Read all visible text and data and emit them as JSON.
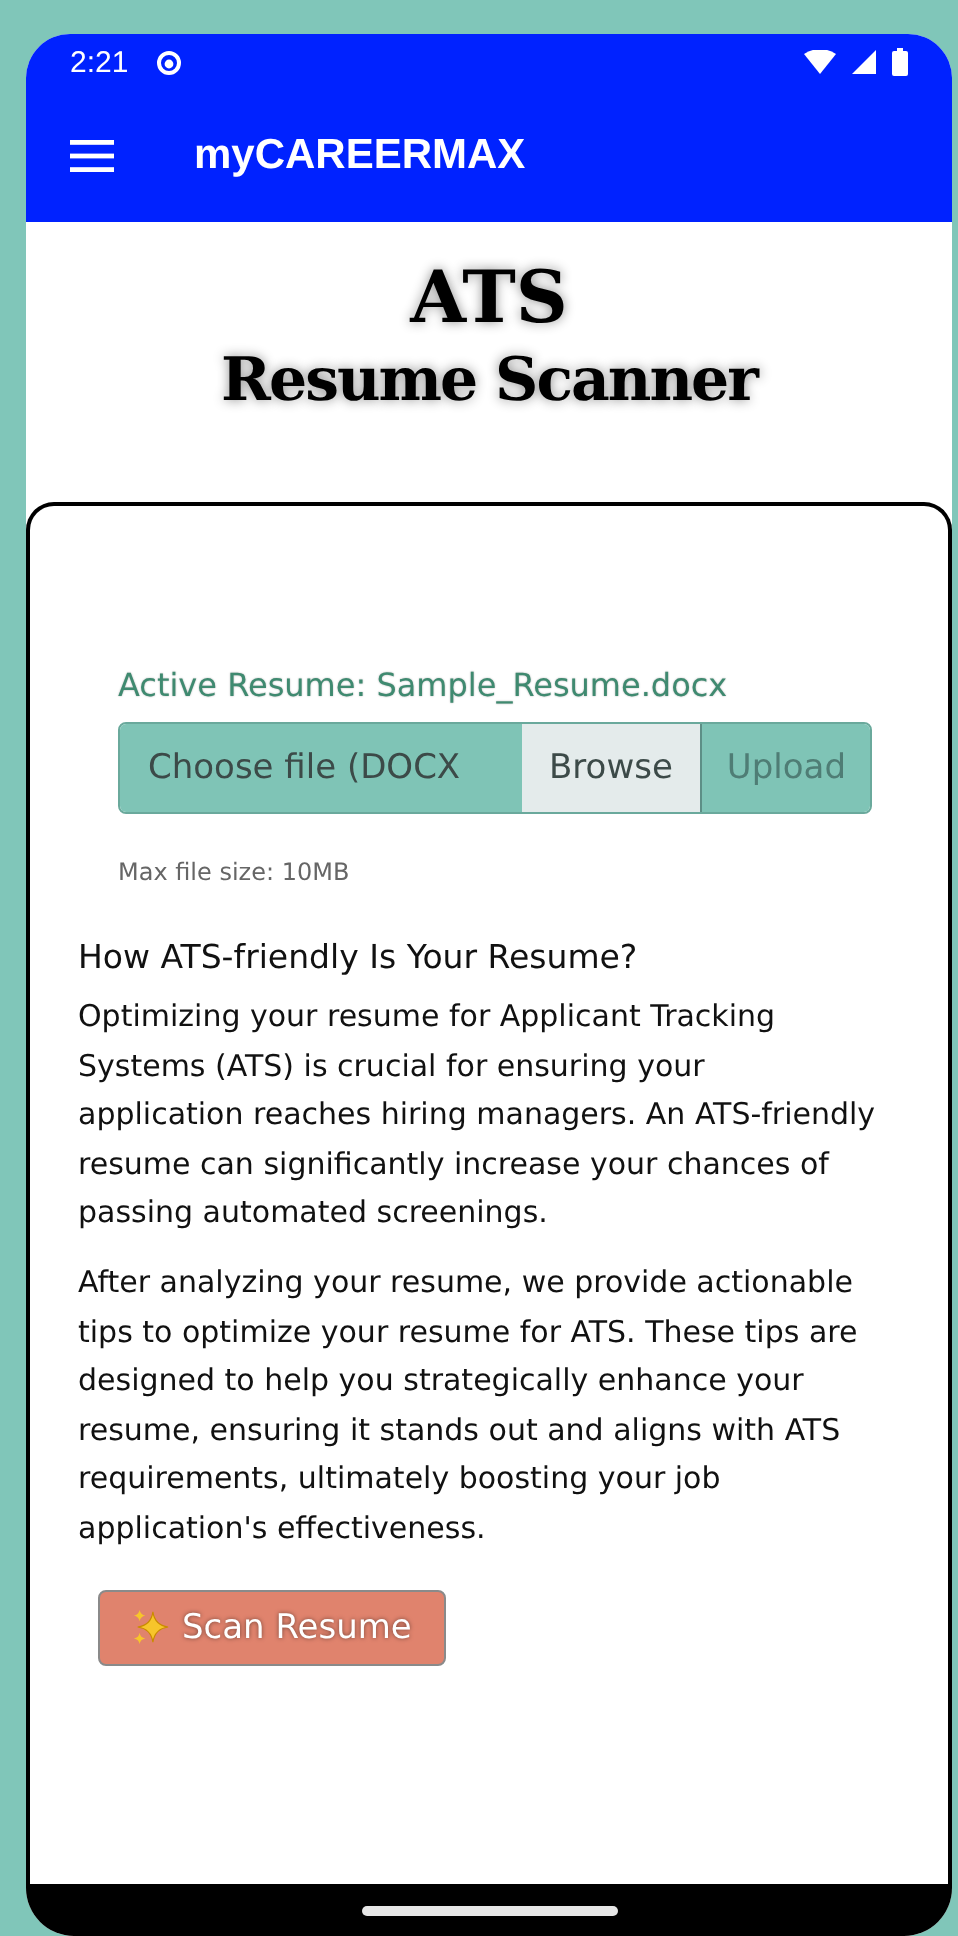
{
  "status_bar": {
    "time": "2:21"
  },
  "app_bar": {
    "title": "myCAREERMAX"
  },
  "header": {
    "title": "ATS",
    "subtitle": "Resume Scanner"
  },
  "upload": {
    "active_label": "Active Resume: Sample_Resume.docx",
    "file_field": {
      "placeholder": "Choose file (DOCX"
    },
    "browse_button": "Browse",
    "upload_button": {
      "label": "Upload",
      "disabled": true
    },
    "note": "Max file size: 10MB"
  },
  "info": {
    "heading": "How ATS-friendly Is Your Resume?",
    "paragraphs": [
      "Optimizing your resume for Applicant Tracking Systems (ATS) is crucial for ensuring your application reaches hiring managers. An ATS-friendly resume can significantly increase your chances of passing automated screenings.",
      "After analyzing your resume, we provide actionable tips to optimize your resume for ATS. These tips are designed to help you strategically enhance your resume, ensuring it stands out and aligns with ATS requirements, ultimately boosting your job application's effectiveness."
    ]
  },
  "scan_button": {
    "label": "Scan Resume"
  }
}
